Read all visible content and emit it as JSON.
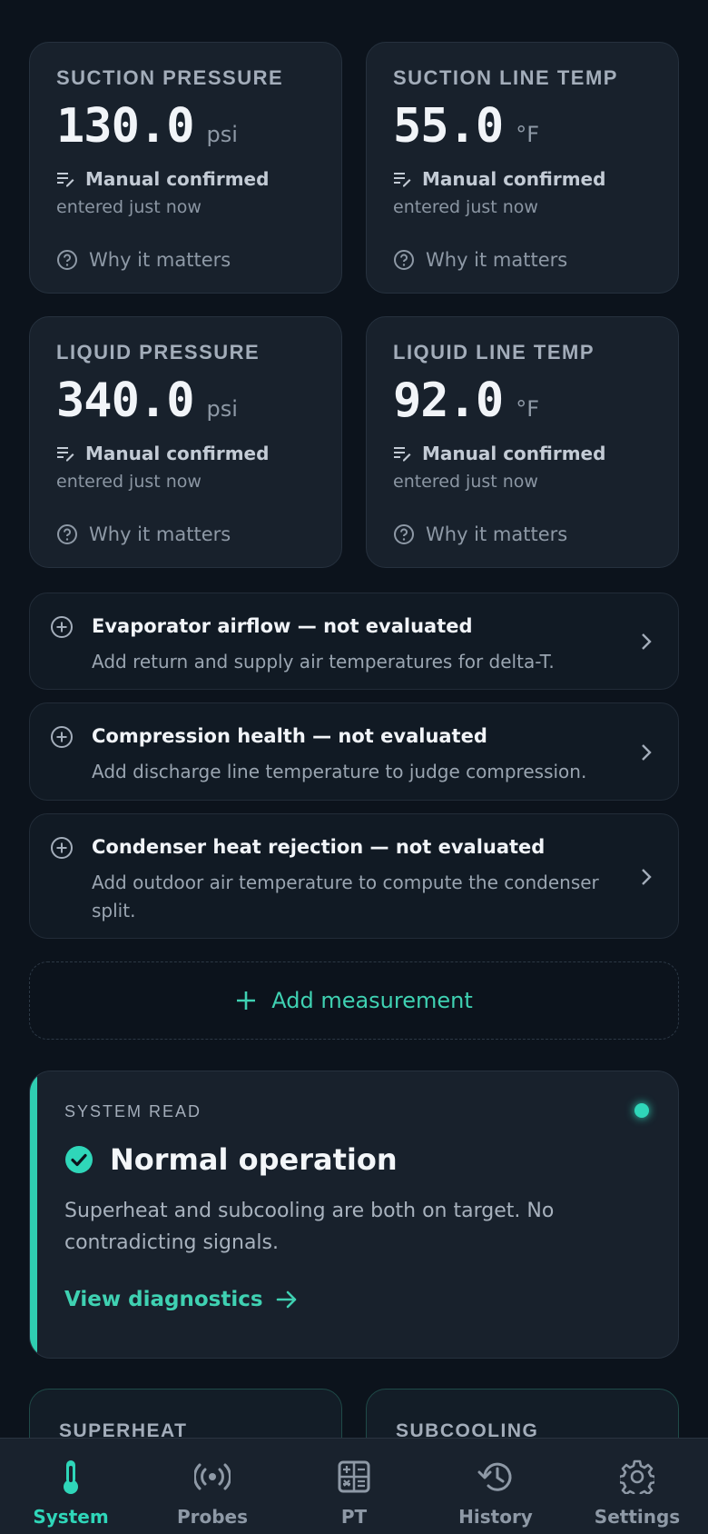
{
  "measurements": [
    {
      "label": "SUCTION PRESSURE",
      "value": "130.0",
      "unit": "psi",
      "source": "Manual confirmed",
      "entered": "entered just now",
      "why": "Why it matters"
    },
    {
      "label": "SUCTION LINE TEMP",
      "value": "55.0",
      "unit": "°F",
      "source": "Manual confirmed",
      "entered": "entered just now",
      "why": "Why it matters"
    },
    {
      "label": "LIQUID PRESSURE",
      "value": "340.0",
      "unit": "psi",
      "source": "Manual confirmed",
      "entered": "entered just now",
      "why": "Why it matters"
    },
    {
      "label": "LIQUID LINE TEMP",
      "value": "92.0",
      "unit": "°F",
      "source": "Manual confirmed",
      "entered": "entered just now",
      "why": "Why it matters"
    }
  ],
  "not_evaluated": [
    {
      "title": "Evaporator airflow — not evaluated",
      "subtitle": "Add return and supply air temperatures for delta-T."
    },
    {
      "title": "Compression health — not evaluated",
      "subtitle": "Add discharge line temperature to judge compression."
    },
    {
      "title": "Condenser heat rejection — not evaluated",
      "subtitle": "Add outdoor air temperature to compute the condenser split."
    }
  ],
  "add_measurement": "Add measurement",
  "system_read": {
    "label": "SYSTEM READ",
    "status": "Normal operation",
    "description": "Superheat and subcooling are both on target. No contradicting signals.",
    "link": "View diagnostics",
    "accent": "#2fcdb1"
  },
  "partial_cards": [
    "SUPERHEAT",
    "SUBCOOLING"
  ],
  "nav": {
    "items": [
      {
        "label": "System",
        "icon": "thermometer-icon",
        "active": true
      },
      {
        "label": "Probes",
        "icon": "broadcast-icon",
        "active": false
      },
      {
        "label": "PT",
        "icon": "calculator-icon",
        "active": false
      },
      {
        "label": "History",
        "icon": "history-icon",
        "active": false
      },
      {
        "label": "Settings",
        "icon": "gear-icon",
        "active": false
      }
    ]
  },
  "colors": {
    "accent": "#2fd6b9",
    "background": "#0c131c",
    "card": "#18212c"
  }
}
